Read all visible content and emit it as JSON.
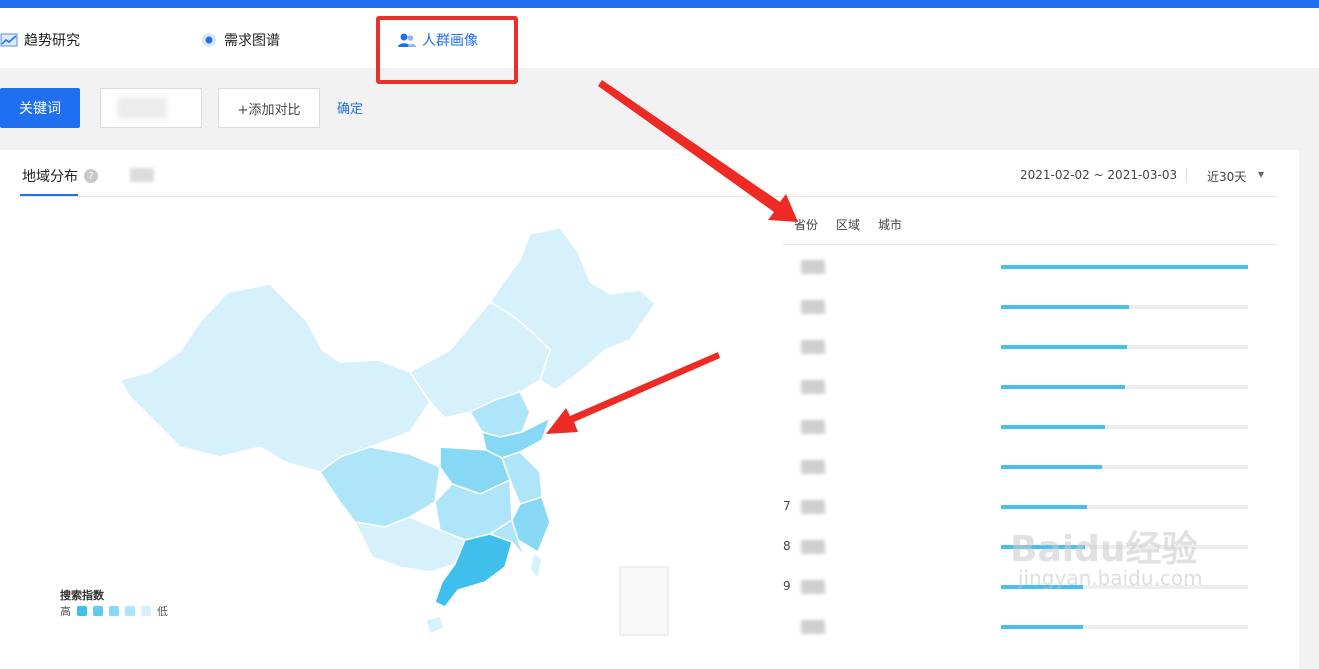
{
  "nav": {
    "items": [
      {
        "label": "趋势研究",
        "icon": "chart-icon"
      },
      {
        "label": "需求图谱",
        "icon": "target-icon"
      },
      {
        "label": "人群画像",
        "icon": "users-icon",
        "active": true
      }
    ]
  },
  "search": {
    "keyword_button": "关键词",
    "add_compare_button": "+添加对比",
    "confirm_link": "确定"
  },
  "panel": {
    "tab": "地域分布",
    "help_icon": "?",
    "date_range": "2021-02-02 ~ 2021-03-03",
    "period": "近30天",
    "subtabs": [
      "省份",
      "区域",
      "城市"
    ]
  },
  "ranking": [
    {
      "rank": "",
      "value": 1.0
    },
    {
      "rank": "",
      "value": 0.52
    },
    {
      "rank": "",
      "value": 0.51
    },
    {
      "rank": "",
      "value": 0.5
    },
    {
      "rank": "",
      "value": 0.42
    },
    {
      "rank": "",
      "value": 0.41
    },
    {
      "rank": "7",
      "value": 0.35
    },
    {
      "rank": "8",
      "value": 0.34
    },
    {
      "rank": "9",
      "value": 0.33
    },
    {
      "rank": "",
      "value": 0.33
    }
  ],
  "legend": {
    "title": "搜索指数",
    "high": "高",
    "low": "低",
    "colors": [
      "#3fbfec",
      "#5fcbf0",
      "#86d8f4",
      "#aee5f8",
      "#d6f1fb"
    ]
  },
  "watermark": {
    "main": "Baidu经验",
    "sub": "jingyan.baidu.com"
  },
  "colors": {
    "accent": "#1f6ff0",
    "highlight_box": "#e8312b",
    "bar": "#47c0ea",
    "map_light": "#d6f1fb",
    "map_mid": "#86d8f4",
    "map_dark": "#3fbfec"
  }
}
